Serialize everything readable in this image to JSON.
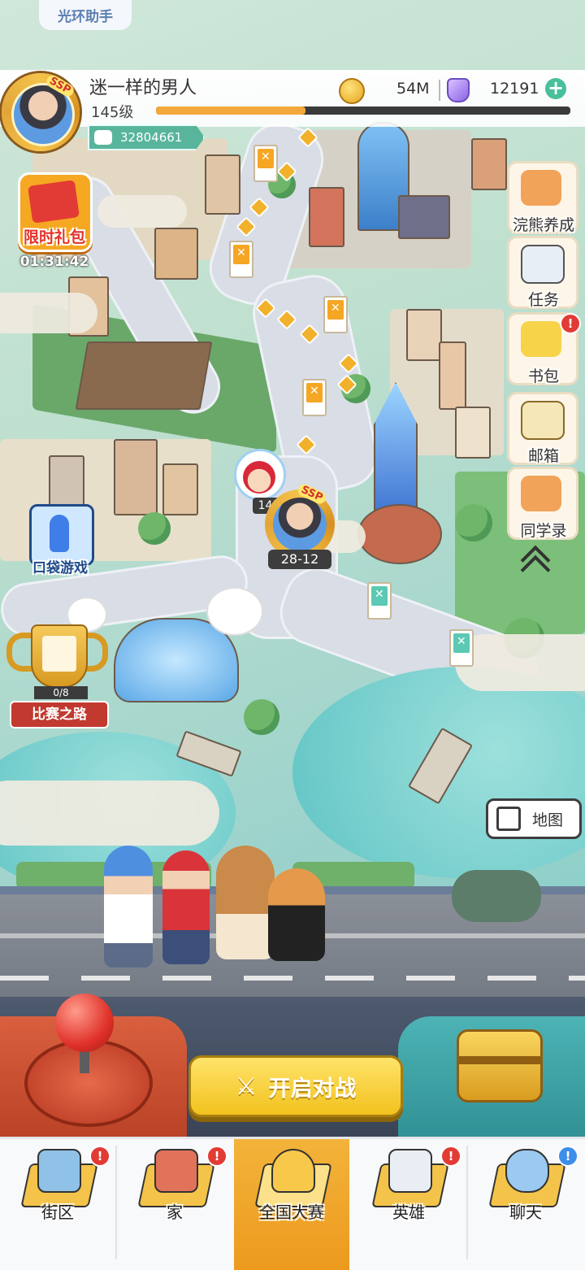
{
  "header": {
    "assistant_label": "光环助手"
  },
  "player": {
    "name": "迷一样的男人",
    "level": "145级",
    "frame_badge": "SSP",
    "xp_progress": 0.36,
    "power": "32804661"
  },
  "currency": {
    "coins": "54M",
    "gems": "12191",
    "add_icon": "plus-icon"
  },
  "left_widgets": {
    "gift": {
      "label": "限时礼包",
      "timer": "01:31:42"
    },
    "pocket_games": {
      "label": "口袋游戏"
    },
    "competition_road": {
      "progress": "0/8",
      "label": "比赛之路"
    }
  },
  "side_menu": [
    {
      "label": "浣熊养成",
      "icon": "raccoon-icon",
      "badge": ""
    },
    {
      "label": "任务",
      "icon": "clipboard-icon",
      "badge": ""
    },
    {
      "label": "书包",
      "icon": "backpack-icon",
      "badge": "!"
    },
    {
      "label": "邮箱",
      "icon": "envelope-icon",
      "badge": ""
    },
    {
      "label": "同学录",
      "icon": "raccoon-book-icon",
      "badge": ""
    }
  ],
  "map": {
    "opponent_level": "145",
    "player_badge": "SSP",
    "player_score": "28-12",
    "map_button": "地图"
  },
  "controls": {
    "start_battle": "开启对战"
  },
  "nav": [
    {
      "label": "街区",
      "icon": "signpost-icon",
      "badge": "!",
      "active": false
    },
    {
      "label": "家",
      "icon": "house-icon",
      "badge": "!",
      "active": false
    },
    {
      "label": "全国大赛",
      "icon": "trophy-icon",
      "badge": "",
      "active": true
    },
    {
      "label": "英雄",
      "icon": "hero-cards-icon",
      "badge": "!",
      "active": false
    },
    {
      "label": "聊天",
      "icon": "chat-bubbles-icon",
      "badge": "!",
      "active": false
    }
  ],
  "colors": {
    "accent_gold": "#f4c34a",
    "active_tab": "#ec9a1e",
    "badge_red": "#e23b35",
    "badge_blue": "#3c8ee8",
    "power_green": "#58b59c"
  }
}
